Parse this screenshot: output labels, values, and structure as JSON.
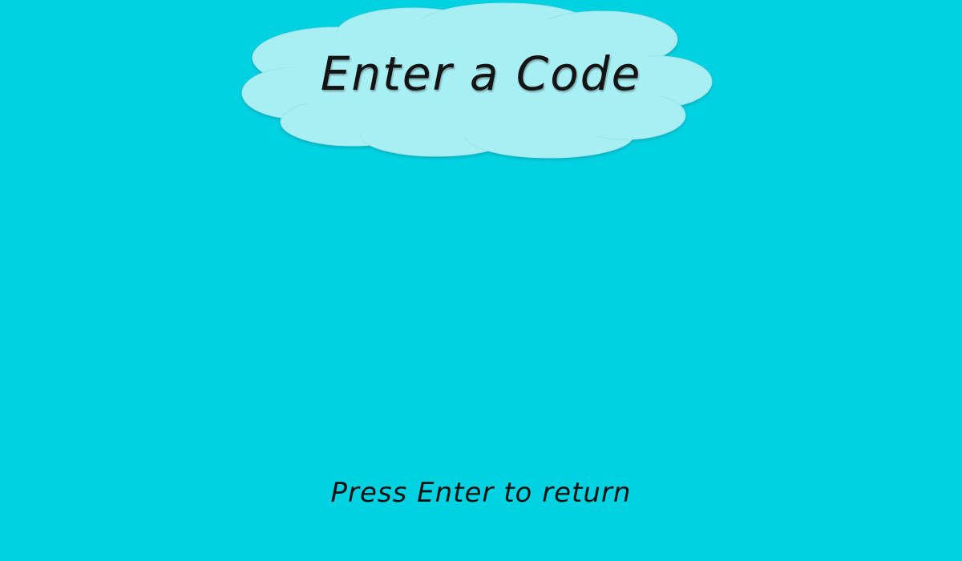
{
  "screen": {
    "title": "Enter a Code",
    "hint": "Press Enter to return"
  },
  "colors": {
    "background": "#00d2e2",
    "cloud_fill": "#a8eff4",
    "text": "#141414"
  },
  "icons": {
    "title_backdrop": "cloud-shape"
  }
}
